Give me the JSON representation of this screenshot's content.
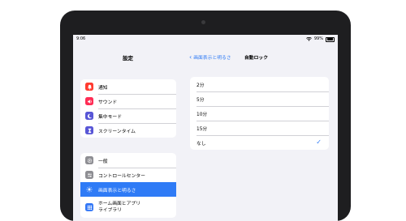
{
  "status": {
    "time": "9:06",
    "battery": "99%"
  },
  "sidebar": {
    "title": "設定",
    "group1": [
      {
        "label": "通知",
        "icon": "bell-icon",
        "color": "#ff3b30"
      },
      {
        "label": "サウンド",
        "icon": "speaker-icon",
        "color": "#ff2d55"
      },
      {
        "label": "集中モード",
        "icon": "moon-icon",
        "color": "#5856d6"
      },
      {
        "label": "スクリーンタイム",
        "icon": "hourglass-icon",
        "color": "#5856d6"
      }
    ],
    "group2": [
      {
        "label": "一般",
        "icon": "gear-icon",
        "color": "#8e8e93"
      },
      {
        "label": "コントロールセンター",
        "icon": "sliders-icon",
        "color": "#8e8e93"
      },
      {
        "label": "画面表示と明るさ",
        "icon": "brightness-icon",
        "color": "#2f7bf6",
        "active": true
      },
      {
        "label": "ホーム画面とアプリ",
        "label2": "ライブラリ",
        "icon": "home-grid-icon",
        "color": "#3478f6"
      }
    ]
  },
  "detail": {
    "back_label": "画面表示と明るさ",
    "title": "自動ロック",
    "options": [
      "2分",
      "5分",
      "10分",
      "15分",
      "なし"
    ],
    "selected": "なし",
    "check_glyph": "✓"
  }
}
